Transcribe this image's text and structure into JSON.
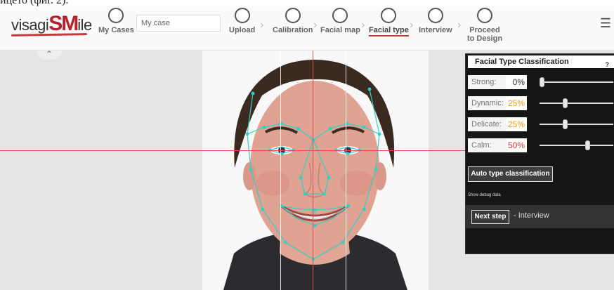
{
  "page_caption_fragment": "ицето (фиг. 2).",
  "header": {
    "logo_prefix": "visagi",
    "logo_sm": "SM",
    "logo_suffix": "ile",
    "case_value": "My case",
    "menu_icon": "hamburger-icon",
    "nav": [
      {
        "label": "My Cases",
        "icon": "folder-icon"
      },
      {
        "label": "Upload",
        "icon": "upload-icon"
      },
      {
        "label": "Calibration",
        "icon": "calibration-icon"
      },
      {
        "label": "Facial map",
        "icon": "facial-map-icon"
      },
      {
        "label": "Facial type",
        "icon": "facial-type-icon"
      },
      {
        "label": "Interview",
        "icon": "interview-icon"
      },
      {
        "label": "Proceed to Design",
        "icon": "proceed-design-icon"
      }
    ]
  },
  "panel": {
    "title": "Facial Type Classification",
    "help": "?",
    "rows": [
      {
        "label": "Strong:",
        "value": "0%",
        "level": 0,
        "color": "#333333"
      },
      {
        "label": "Dynamic:",
        "value": "25%",
        "level": 25,
        "color": "#e6a21b"
      },
      {
        "label": "Delicate:",
        "value": "25%",
        "level": 25,
        "color": "#e6a21b"
      },
      {
        "label": "Calm:",
        "value": "50%",
        "level": 50,
        "color": "#d83434"
      }
    ],
    "auto_button": "Auto type classification",
    "debug_link": "Show debug data",
    "next_button": "Next step",
    "next_text": "- Interview"
  },
  "colors": {
    "accent_red": "#c53b3b",
    "guide_red": "#e24e4e",
    "landmark_cyan": "#2fd1c5"
  }
}
